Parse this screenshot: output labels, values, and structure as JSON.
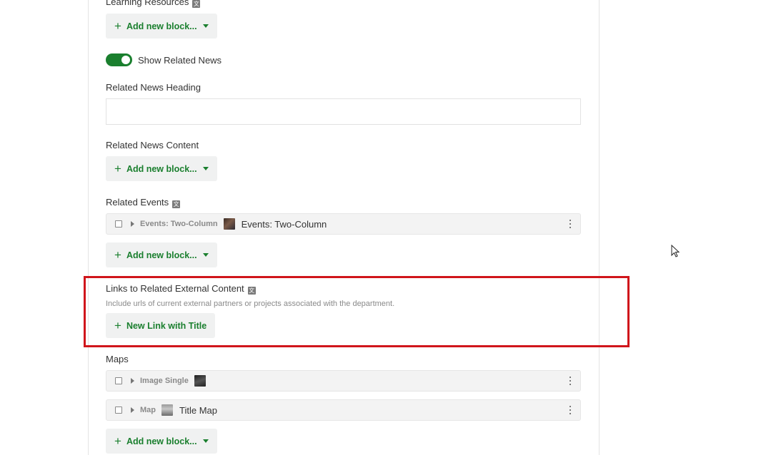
{
  "sections": {
    "learning_resources": {
      "label": "Learning Resources",
      "add_button": "Add new block..."
    },
    "show_related_news": {
      "label": "Show Related News",
      "checked": true
    },
    "related_news_heading": {
      "label": "Related News Heading",
      "value": ""
    },
    "related_news_content": {
      "label": "Related News Content",
      "add_button": "Add new block..."
    },
    "related_events": {
      "label": "Related Events",
      "items": [
        {
          "type": "Events: Two-Column",
          "title": "Events: Two-Column"
        }
      ],
      "add_button": "Add new block..."
    },
    "external_links": {
      "label": "Links to Related External Content",
      "description": "Include urls of current external partners or projects associated with the department.",
      "button": "New Link with Title"
    },
    "maps": {
      "label": "Maps",
      "items": [
        {
          "type": "Image Single",
          "title": ""
        },
        {
          "type": "Map",
          "title": "Title Map"
        }
      ],
      "add_button": "Add new block..."
    }
  },
  "icons": {
    "translate": "translate-icon",
    "plus": "+",
    "caret": "chevron-down-icon",
    "menu": "kebab-menu-icon"
  },
  "colors": {
    "accent_green": "#1a7f2e",
    "highlight_red": "#d0151b",
    "button_bg": "#f0f1f1",
    "row_bg": "#f3f3f3"
  }
}
